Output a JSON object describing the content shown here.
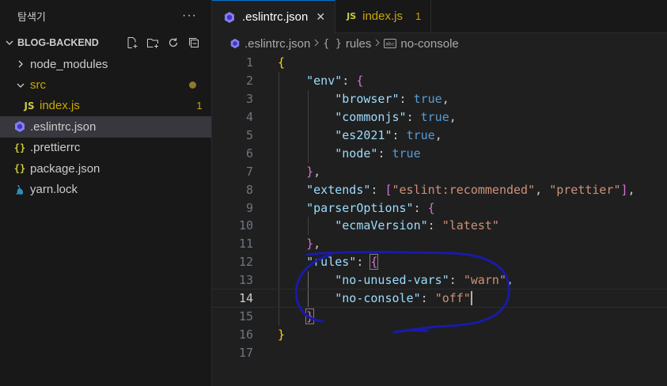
{
  "sidebar": {
    "title": "탐색기",
    "more": "···",
    "section_title": "BLOG-BACKEND",
    "items": [
      {
        "label": "node_modules"
      },
      {
        "label": "src"
      },
      {
        "label": "index.js",
        "badge": "1"
      },
      {
        "label": ".eslintrc.json"
      },
      {
        "label": ".prettierrc"
      },
      {
        "label": "package.json"
      },
      {
        "label": "yarn.lock"
      }
    ]
  },
  "tabs": [
    {
      "label": ".eslintrc.json",
      "close": "✕"
    },
    {
      "label": "index.js",
      "badge": "1",
      "icon": "JS"
    }
  ],
  "breadcrumb": {
    "file": ".eslintrc.json",
    "rules": "rules",
    "item": "no-console"
  },
  "icons": {
    "js": "JS",
    "braces": "{}",
    "crumb_braces": "{ }"
  },
  "code": {
    "line_numbers": [
      "1",
      "2",
      "3",
      "4",
      "5",
      "6",
      "7",
      "8",
      "9",
      "10",
      "11",
      "12",
      "13",
      "14",
      "15",
      "16",
      "17"
    ],
    "current_line": 14
  },
  "colors": {
    "accent": "#0078d4",
    "string": "#ce9178",
    "key": "#9cdcfe",
    "boolean": "#569cd6",
    "annotation": "#1a1aa8"
  }
}
